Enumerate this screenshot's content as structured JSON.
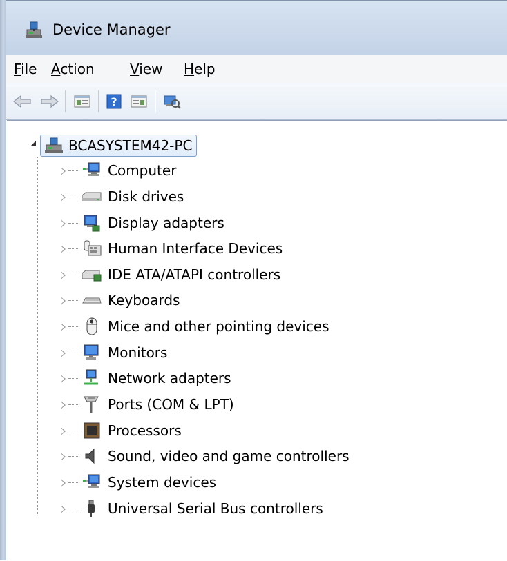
{
  "window": {
    "title": "Device Manager"
  },
  "menu": {
    "file": {
      "accel": "F",
      "rest": "ile"
    },
    "action": {
      "accel": "A",
      "rest": "ction"
    },
    "view": {
      "accel": "V",
      "rest": "iew"
    },
    "help": {
      "accel": "H",
      "rest": "elp"
    }
  },
  "toolbar": {
    "buttons": [
      "back-icon",
      "forward-icon",
      "properties-icon",
      "help-icon",
      "update-driver-icon",
      "scan-hardware-icon"
    ]
  },
  "tree": {
    "root": {
      "label": "BCASYSTEM42-PC",
      "icon": "computer-network-icon",
      "expanded": true
    },
    "items": [
      {
        "label": "Computer",
        "icon": "computer-icon"
      },
      {
        "label": "Disk drives",
        "icon": "disk-drive-icon"
      },
      {
        "label": "Display adapters",
        "icon": "display-adapter-icon"
      },
      {
        "label": "Human Interface Devices",
        "icon": "hid-icon"
      },
      {
        "label": "IDE ATA/ATAPI controllers",
        "icon": "ide-controller-icon"
      },
      {
        "label": "Keyboards",
        "icon": "keyboard-icon"
      },
      {
        "label": "Mice and other pointing devices",
        "icon": "mouse-icon"
      },
      {
        "label": "Monitors",
        "icon": "monitor-icon"
      },
      {
        "label": "Network adapters",
        "icon": "network-adapter-icon"
      },
      {
        "label": "Ports (COM & LPT)",
        "icon": "port-icon"
      },
      {
        "label": "Processors",
        "icon": "processor-icon"
      },
      {
        "label": "Sound, video and game controllers",
        "icon": "speaker-icon"
      },
      {
        "label": "System devices",
        "icon": "system-device-icon"
      },
      {
        "label": "Universal Serial Bus controllers",
        "icon": "usb-icon"
      }
    ]
  },
  "colors": {
    "titlebar": "#cfdced",
    "selection_border": "#7da2ce",
    "menubar": "#f5f6f7"
  }
}
